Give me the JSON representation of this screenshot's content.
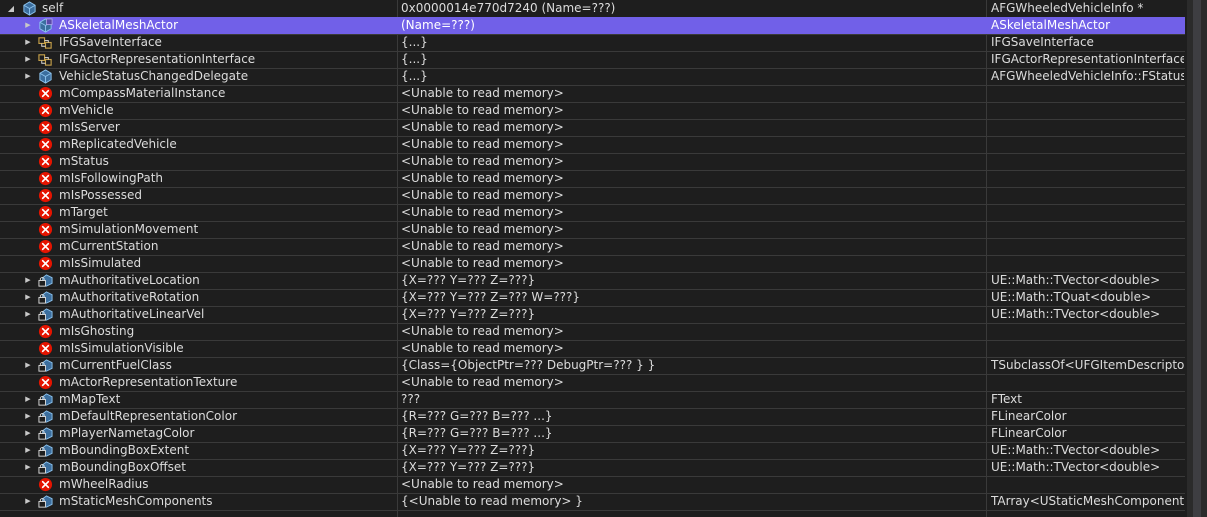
{
  "watch": {
    "root": {
      "name": "self",
      "value": "0x0000014e770d7240 (Name=???)",
      "type": "AFGWheeledVehicleInfo *"
    },
    "rows": [
      {
        "name": "ASkeletalMeshActor",
        "value": "(Name=???)",
        "type": "ASkeletalMeshActor",
        "icon": "class-icon",
        "expandable": true
      },
      {
        "name": "IFGSaveInterface",
        "value": "{...}",
        "type": "IFGSaveInterface",
        "icon": "interface-icon",
        "expandable": true
      },
      {
        "name": "IFGActorRepresentationInterface",
        "value": "{...}",
        "type": "IFGActorRepresentationInterface",
        "icon": "interface-icon",
        "expandable": true
      },
      {
        "name": "VehicleStatusChangedDelegate",
        "value": "{...}",
        "type": "AFGWheeledVehicleInfo::FStatusC...",
        "icon": "field-icon",
        "expandable": true
      },
      {
        "name": "mCompassMaterialInstance",
        "value": "<Unable to read memory>",
        "type": "",
        "icon": "error-icon",
        "expandable": false
      },
      {
        "name": "mVehicle",
        "value": "<Unable to read memory>",
        "type": "",
        "icon": "error-icon",
        "expandable": false
      },
      {
        "name": "mIsServer",
        "value": "<Unable to read memory>",
        "type": "",
        "icon": "error-icon",
        "expandable": false
      },
      {
        "name": "mReplicatedVehicle",
        "value": "<Unable to read memory>",
        "type": "",
        "icon": "error-icon",
        "expandable": false
      },
      {
        "name": "mStatus",
        "value": "<Unable to read memory>",
        "type": "",
        "icon": "error-icon",
        "expandable": false
      },
      {
        "name": "mIsFollowingPath",
        "value": "<Unable to read memory>",
        "type": "",
        "icon": "error-icon",
        "expandable": false
      },
      {
        "name": "mIsPossessed",
        "value": "<Unable to read memory>",
        "type": "",
        "icon": "error-icon",
        "expandable": false
      },
      {
        "name": "mTarget",
        "value": "<Unable to read memory>",
        "type": "",
        "icon": "error-icon",
        "expandable": false
      },
      {
        "name": "mSimulationMovement",
        "value": "<Unable to read memory>",
        "type": "",
        "icon": "error-icon",
        "expandable": false
      },
      {
        "name": "mCurrentStation",
        "value": "<Unable to read memory>",
        "type": "",
        "icon": "error-icon",
        "expandable": false
      },
      {
        "name": "mIsSimulated",
        "value": "<Unable to read memory>",
        "type": "",
        "icon": "error-icon",
        "expandable": false
      },
      {
        "name": "mAuthoritativeLocation",
        "value": "{X=??? Y=??? Z=???}",
        "type": "UE::Math::TVector<double>",
        "icon": "private-field-icon",
        "expandable": true
      },
      {
        "name": "mAuthoritativeRotation",
        "value": "{X=??? Y=??? Z=??? W=???}",
        "type": "UE::Math::TQuat<double>",
        "icon": "private-field-icon",
        "expandable": true
      },
      {
        "name": "mAuthoritativeLinearVel",
        "value": "{X=??? Y=??? Z=???}",
        "type": "UE::Math::TVector<double>",
        "icon": "private-field-icon",
        "expandable": true
      },
      {
        "name": "mIsGhosting",
        "value": "<Unable to read memory>",
        "type": "",
        "icon": "error-icon",
        "expandable": false
      },
      {
        "name": "mIsSimulationVisible",
        "value": "<Unable to read memory>",
        "type": "",
        "icon": "error-icon",
        "expandable": false
      },
      {
        "name": "mCurrentFuelClass",
        "value": "{Class={ObjectPtr=??? DebugPtr=??? } }",
        "type": "TSubclassOf<UFGItemDescriptor>",
        "icon": "private-field-icon",
        "expandable": true
      },
      {
        "name": "mActorRepresentationTexture",
        "value": "<Unable to read memory>",
        "type": "",
        "icon": "error-icon",
        "expandable": false
      },
      {
        "name": "mMapText",
        "value": "???",
        "type": "FText",
        "icon": "private-field-icon",
        "expandable": true
      },
      {
        "name": "mDefaultRepresentationColor",
        "value": "{R=??? G=??? B=??? ...}",
        "type": "FLinearColor",
        "icon": "private-field-icon",
        "expandable": true
      },
      {
        "name": "mPlayerNametagColor",
        "value": "{R=??? G=??? B=??? ...}",
        "type": "FLinearColor",
        "icon": "private-field-icon",
        "expandable": true
      },
      {
        "name": "mBoundingBoxExtent",
        "value": "{X=??? Y=??? Z=???}",
        "type": "UE::Math::TVector<double>",
        "icon": "private-field-icon",
        "expandable": true
      },
      {
        "name": "mBoundingBoxOffset",
        "value": "{X=??? Y=??? Z=???}",
        "type": "UE::Math::TVector<double>",
        "icon": "private-field-icon",
        "expandable": true
      },
      {
        "name": "mWheelRadius",
        "value": "<Unable to read memory>",
        "type": "",
        "icon": "error-icon",
        "expandable": false
      },
      {
        "name": "mStaticMeshComponents",
        "value": "{<Unable to read memory> }",
        "type": "TArray<UStaticMeshComponent *,...",
        "icon": "private-field-icon",
        "expandable": true
      }
    ],
    "selected_index": 0
  },
  "colors": {
    "background": "#1e1e1e",
    "text": "#dcdcdc",
    "selection": "#7160e8",
    "error": "#e51400",
    "cube": "#6aaad8",
    "interface": "#c8a24a"
  }
}
